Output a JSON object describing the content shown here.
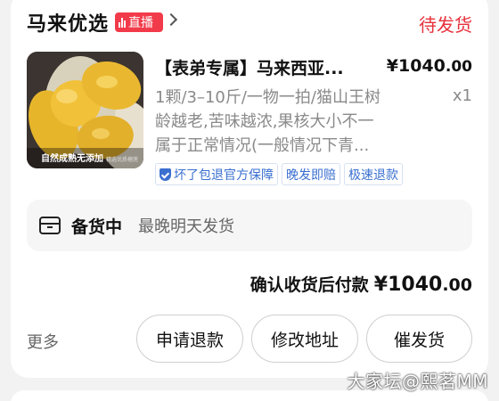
{
  "shop": {
    "name": "马来优选",
    "live_badge": "直播",
    "order_status": "待发货"
  },
  "product": {
    "image_caption": "自然成熟无添加",
    "image_caption_small": "精选优质榴莲",
    "title": "【表弟专属】马来西亚...",
    "price_main": "¥1040",
    "price_decimal": ".00",
    "spec_lines": [
      "1颗/3–10斤/一物一拍/猫山王树",
      "龄越老,苦味越浓,果核大小不一",
      "属于正常情况(一般情况下青..."
    ],
    "quantity": "x1",
    "tags": [
      "坏了包退官方保障",
      "晚发即赔",
      "极速退款"
    ]
  },
  "stock": {
    "label": "备货中",
    "note": "最晚明天发货"
  },
  "payment": {
    "label": "确认收货后付款",
    "amount_main": "¥1040",
    "amount_decimal": ".00"
  },
  "actions": {
    "more": "更多",
    "refund": "申请退款",
    "change_address": "修改地址",
    "urge_shipping": "催发货"
  },
  "watermark": "大家坛@熙茗MM",
  "colors": {
    "status_red": "#e8313c",
    "live_badge": "#f23b4a",
    "tag_blue": "#3a6fd0"
  }
}
